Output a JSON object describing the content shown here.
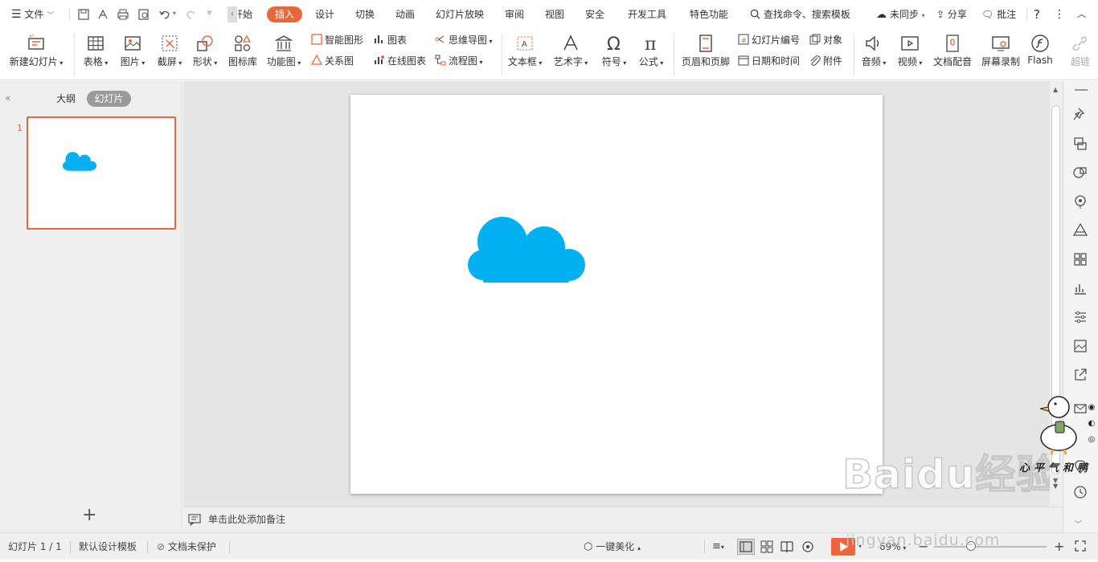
{
  "menubar": {
    "file": "文件",
    "tabs": [
      "开始",
      "插入",
      "设计",
      "切换",
      "动画",
      "幻灯片放映",
      "审阅",
      "视图",
      "安全",
      "开发工具",
      "特色功能"
    ],
    "search": "查找命令、搜索模板",
    "sync": "未同步",
    "share": "分享",
    "comment": "批注"
  },
  "ribbon": {
    "new_slide": "新建幻灯片",
    "table": "表格",
    "picture": "图片",
    "screenshot": "截屏",
    "shape": "形状",
    "icon_lib": "图标库",
    "func_chart": "功能图",
    "smart_shape": "智能图形",
    "chart": "图表",
    "relation": "关系图",
    "online_chart": "在线图表",
    "mindmap": "思维导图",
    "flowchart": "流程图",
    "textbox": "文本框",
    "wordart": "艺术字",
    "symbol": "符号",
    "formula": "公式",
    "header_footer": "页眉和页脚",
    "slide_number": "幻灯片编号",
    "object": "对象",
    "date_time": "日期和时间",
    "attachment": "附件",
    "audio": "音频",
    "video": "视频",
    "doc_dubbing": "文档配音",
    "screen_record": "屏幕录制",
    "flash": "Flash",
    "hyperlink": "超链"
  },
  "panel": {
    "outline_tab": "大纲",
    "slides_tab": "幻灯片",
    "slide_index": "1"
  },
  "notes_placeholder": "单击此处添加备注",
  "status": {
    "slide_info": "幻灯片 1 / 1",
    "template": "默认设计模板",
    "protect": "文档未保护",
    "beautify": "一键美化",
    "zoom": "69%"
  },
  "watermark": {
    "baidu_text": "Baidu经验",
    "url": "jingyan.baidu.com",
    "author": "心平气和鸭"
  },
  "colors": {
    "accent": "#e8683c",
    "cloud": "#00b0f0",
    "play": "#f0643c"
  }
}
